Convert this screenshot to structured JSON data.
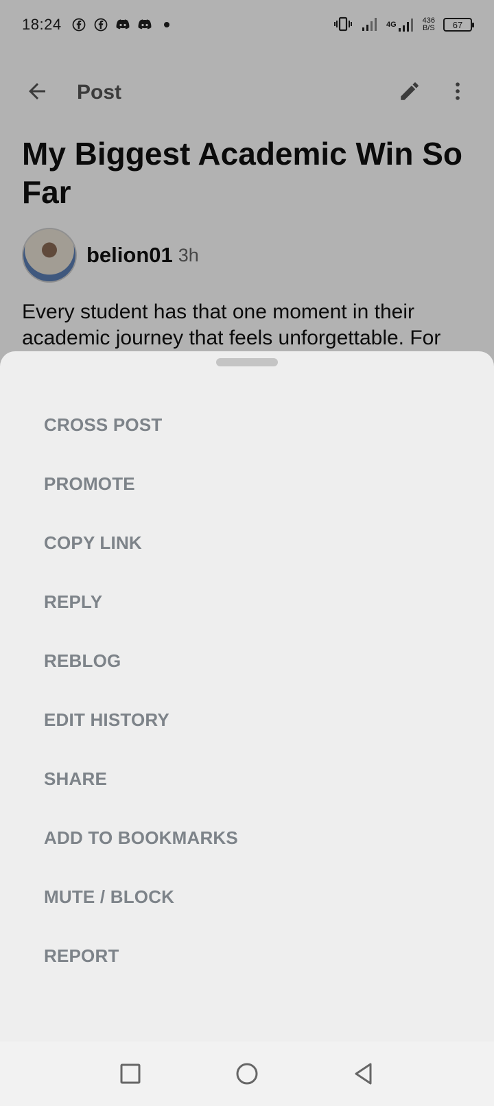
{
  "status_bar": {
    "time": "18:24",
    "network_type": "4G",
    "net_speed_value": "436",
    "net_speed_unit": "B/S",
    "battery_level": "67",
    "left_icons": [
      "facebook-icon",
      "facebook-icon",
      "discord-icon",
      "discord-icon",
      "dot-icon"
    ],
    "right_icons": [
      "vibrate-icon",
      "signal-icon",
      "signal-icon",
      "battery-icon"
    ]
  },
  "app_bar": {
    "title": "Post",
    "icons": [
      "back-arrow-icon",
      "edit-pencil-icon",
      "more-vert-icon"
    ]
  },
  "post": {
    "title": "My Biggest Academic Win So Far",
    "author": "belion01",
    "age": "3h",
    "body": "Every student has that one moment in their academic journey that feels unforgettable. For"
  },
  "sheet": {
    "items": [
      {
        "label": "CROSS POST"
      },
      {
        "label": "PROMOTE"
      },
      {
        "label": "COPY LINK"
      },
      {
        "label": "REPLY"
      },
      {
        "label": "REBLOG"
      },
      {
        "label": "EDIT HISTORY"
      },
      {
        "label": "SHARE"
      },
      {
        "label": "ADD TO BOOKMARKS"
      },
      {
        "label": "MUTE / BLOCK"
      },
      {
        "label": "REPORT"
      }
    ]
  },
  "nav_bar": {
    "icons": [
      "recents-square-icon",
      "home-circle-icon",
      "back-triangle-icon"
    ]
  },
  "colors": {
    "sheet_background": "#eeeeee",
    "menu_text": "#7d8389",
    "scrim": "#000000"
  }
}
